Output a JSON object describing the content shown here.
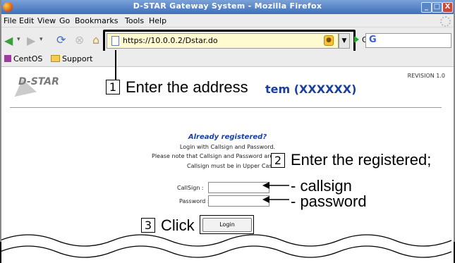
{
  "window": {
    "title": "D-STAR Gateway System - Mozilla Firefox",
    "controls": [
      "_",
      "□",
      "X"
    ]
  },
  "menu": [
    "File",
    "Edit",
    "View",
    "Go",
    "Bookmarks",
    "Tools",
    "Help"
  ],
  "nav": {
    "url": "https://10.0.0.2/Dstar.do",
    "go_label": "Go",
    "search_engine_glyph": "G"
  },
  "bookmarks": [
    "CentOS",
    "Support"
  ],
  "page": {
    "revision": "REVISION 1.0",
    "logo_text": "D-STAR",
    "system_name_visible": "tem (XXXXXX)",
    "already_registered": "Already registered?",
    "login_hint": "Login with Callsign and Password.",
    "note_line": "Please note that Callsign and Password are",
    "note_line2": "Callsign must be in Upper Cas",
    "callsign_label": "CallSign :",
    "password_label": "Password :",
    "login_button": "Login"
  },
  "annotations": {
    "step1": {
      "num": "1",
      "text": "Enter the address"
    },
    "step2": {
      "num": "2",
      "text": "Enter the registered;"
    },
    "callsign_note": "- callsign",
    "password_note": "- password",
    "step3": {
      "num": "3",
      "text": "Click"
    }
  }
}
